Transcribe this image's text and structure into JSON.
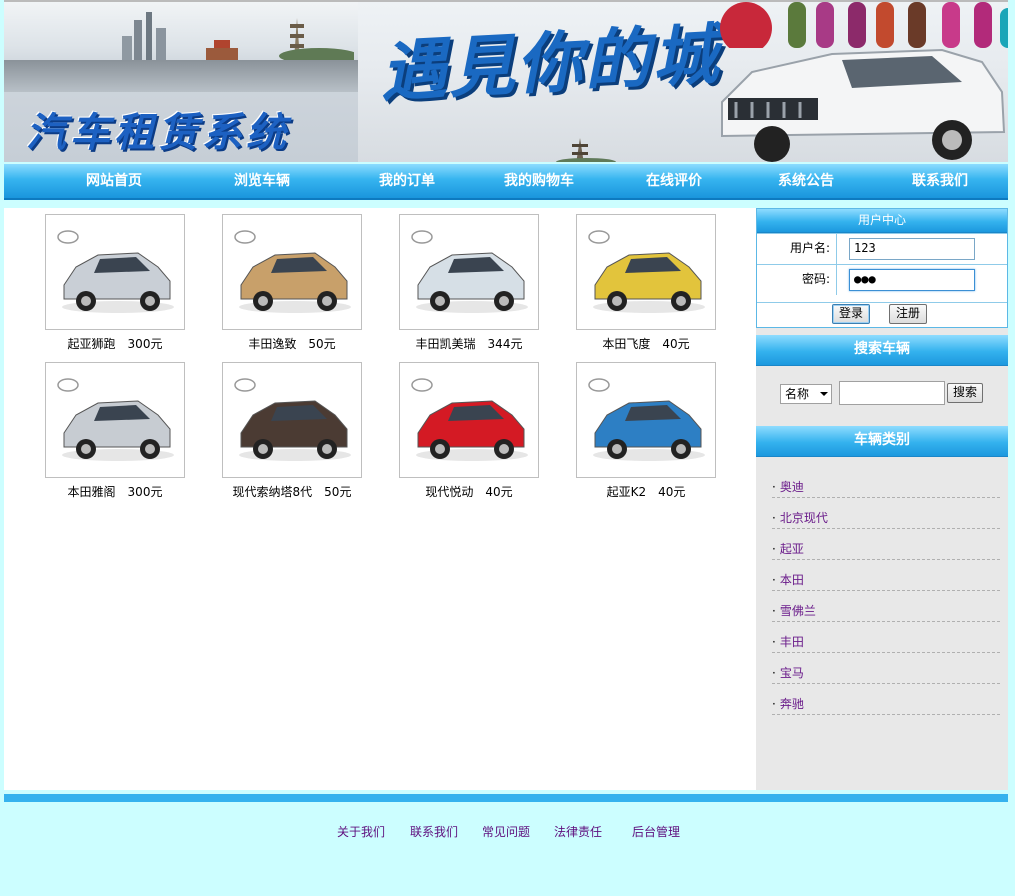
{
  "banner": {
    "title": "汽车租赁系统",
    "slogan": "遇見你的城"
  },
  "nav": {
    "items": [
      "网站首页",
      "浏览车辆",
      "我的订单",
      "我的购物车",
      "在线评价",
      "系统公告",
      "联系我们"
    ]
  },
  "cars": [
    {
      "name": "起亚狮跑",
      "price": "300元",
      "brand_logo": "kia-logo",
      "color": "#c9cfd6"
    },
    {
      "name": "丰田逸致",
      "price": "50元",
      "brand_logo": "toyota-logo",
      "color": "#c8a06a"
    },
    {
      "name": "丰田凯美瑞",
      "price": "344元",
      "brand_logo": "toyota-logo",
      "color": "#d6dfe6"
    },
    {
      "name": "本田飞度",
      "price": "40元",
      "brand_logo": "honda-logo",
      "color": "#e2c43c"
    },
    {
      "name": "本田雅阁",
      "price": "300元",
      "brand_logo": "honda-logo",
      "color": "#c7ccd2"
    },
    {
      "name": "现代索纳塔8代",
      "price": "50元",
      "brand_logo": "hyundai-logo",
      "color": "#4b3b33"
    },
    {
      "name": "现代悦动",
      "price": "40元",
      "brand_logo": "hyundai-logo",
      "color": "#d41a24"
    },
    {
      "name": "起亚K2",
      "price": "40元",
      "brand_logo": "kia-logo",
      "color": "#2d7fc4"
    }
  ],
  "user_center": {
    "title": "用户中心",
    "username_label": "用户名:",
    "username_value": "123",
    "password_label": "密码:",
    "password_value": "●●●",
    "login_button": "登录",
    "register_button": "注册"
  },
  "search": {
    "title": "搜索车辆",
    "select_value": "名称",
    "button": "搜索"
  },
  "category": {
    "title": "车辆类别",
    "items": [
      "奥迪",
      "北京现代",
      "起亚",
      "本田",
      "雪佛兰",
      "丰田",
      "宝马",
      "奔驰"
    ]
  },
  "footer": {
    "links": [
      "关于我们",
      "联系我们",
      "常见问题",
      "法律责任",
      "后台管理"
    ]
  },
  "colors": {
    "nav_blue": "#1a95dd",
    "page_bg": "#ccfeff",
    "link_purple": "#6a1b8a"
  }
}
